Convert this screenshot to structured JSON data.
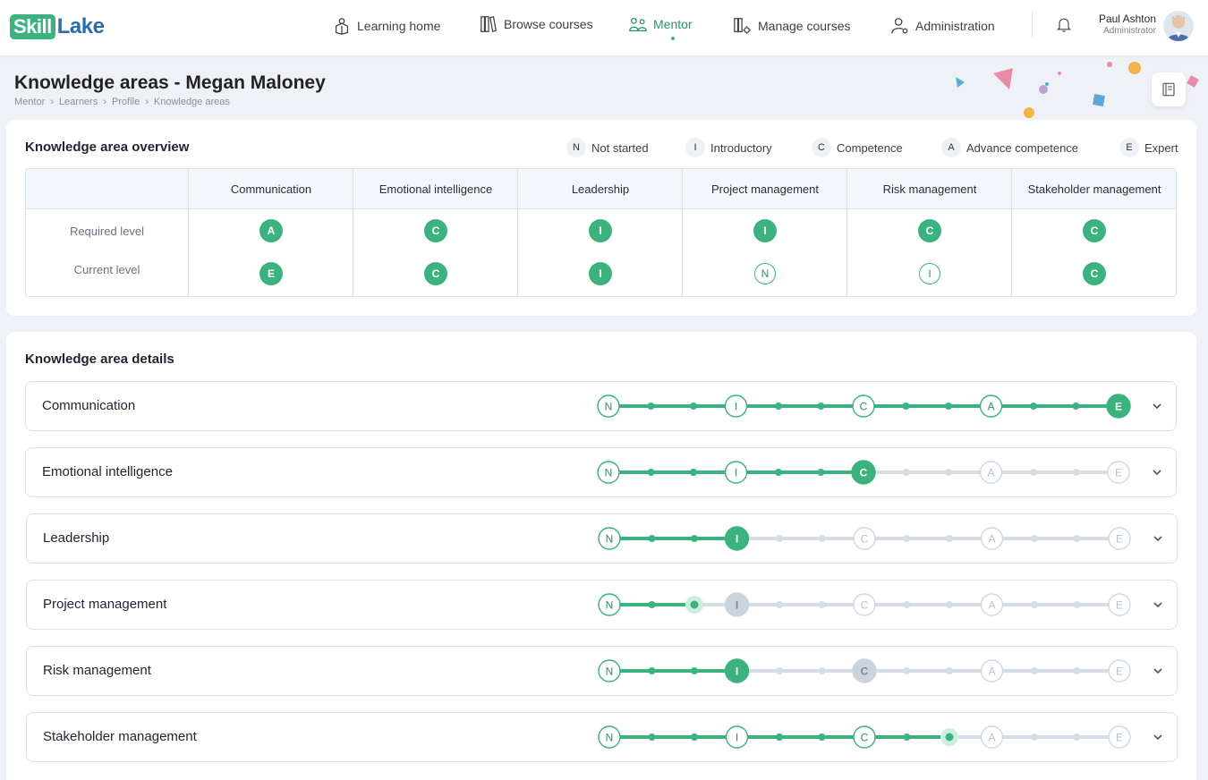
{
  "brand": {
    "part1": "Skill",
    "part2": "Lake"
  },
  "nav": {
    "items": [
      {
        "label": "Learning home",
        "icon": "learning-home-icon"
      },
      {
        "label": "Browse courses",
        "icon": "books-icon"
      },
      {
        "label": "Mentor",
        "icon": "mentor-icon",
        "active": true
      },
      {
        "label": "Manage courses",
        "icon": "manage-courses-icon"
      },
      {
        "label": "Administration",
        "icon": "admin-user-icon"
      }
    ],
    "user": {
      "name": "Paul Ashton",
      "role": "Administrator"
    }
  },
  "page": {
    "title": "Knowledge areas - Megan Maloney",
    "breadcrumb": [
      "Mentor",
      "Learners",
      "Profile",
      "Knowledge areas"
    ]
  },
  "overview": {
    "title": "Knowledge area overview",
    "legend": [
      {
        "code": "N",
        "label": "Not started"
      },
      {
        "code": "I",
        "label": "Introductory"
      },
      {
        "code": "C",
        "label": "Competence"
      },
      {
        "code": "A",
        "label": "Advance competence"
      },
      {
        "code": "E",
        "label": "Expert"
      }
    ],
    "row_labels": {
      "required": "Required level",
      "current": "Current level"
    },
    "areas": [
      {
        "name": "Communication",
        "required": "A",
        "current": "E",
        "current_style": "filled"
      },
      {
        "name": "Emotional intelligence",
        "required": "C",
        "current": "C",
        "current_style": "filled"
      },
      {
        "name": "Leadership",
        "required": "I",
        "current": "I",
        "current_style": "filled"
      },
      {
        "name": "Project management",
        "required": "I",
        "current": "N",
        "current_style": "outline"
      },
      {
        "name": "Risk management",
        "required": "C",
        "current": "I",
        "current_style": "outline"
      },
      {
        "name": "Stakeholder management",
        "required": "C",
        "current": "C",
        "current_style": "filled"
      }
    ]
  },
  "details": {
    "title": "Knowledge area details",
    "levels": [
      "N",
      "I",
      "C",
      "A",
      "E"
    ],
    "rows": [
      {
        "name": "Communication",
        "progress_step": 12,
        "highlight": null
      },
      {
        "name": "Emotional intelligence",
        "progress_step": 6,
        "highlight": null
      },
      {
        "name": "Leadership",
        "progress_step": 3,
        "highlight": null
      },
      {
        "name": "Project management",
        "progress_step": 2,
        "highlight": "I"
      },
      {
        "name": "Risk management",
        "progress_step": 3,
        "highlight": "C"
      },
      {
        "name": "Stakeholder management",
        "progress_step": 8,
        "highlight": null
      }
    ]
  },
  "colors": {
    "accent": "#3cb37f",
    "accent_dark": "#2e8f6d",
    "track_grey": "#d5dde6",
    "highlight_grey": "#cbd4de"
  }
}
